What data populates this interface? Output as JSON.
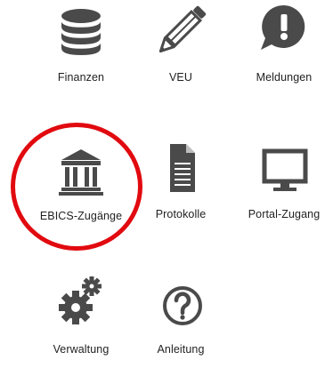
{
  "tiles": [
    {
      "key": "finanzen",
      "label": "Finanzen",
      "icon": "coins-stack-icon"
    },
    {
      "key": "veu",
      "label": "VEU",
      "icon": "pencil-icon"
    },
    {
      "key": "meldungen",
      "label": "Meldungen",
      "icon": "alert-bubble-icon"
    },
    {
      "key": "ebics",
      "label": "EBICS-Zugänge",
      "icon": "bank-building-icon"
    },
    {
      "key": "protokolle",
      "label": "Protokolle",
      "icon": "document-icon"
    },
    {
      "key": "portal",
      "label": "Portal-Zugang",
      "icon": "monitor-icon"
    },
    {
      "key": "verwaltung",
      "label": "Verwaltung",
      "icon": "gears-icon"
    },
    {
      "key": "anleitung",
      "label": "Anleitung",
      "icon": "question-circle-icon"
    }
  ],
  "colors": {
    "icon": "#4a4a4a",
    "highlight": "#e10a0f",
    "background": "#ffffff"
  },
  "highlight": {
    "target": "ebics",
    "shape": "circle"
  }
}
